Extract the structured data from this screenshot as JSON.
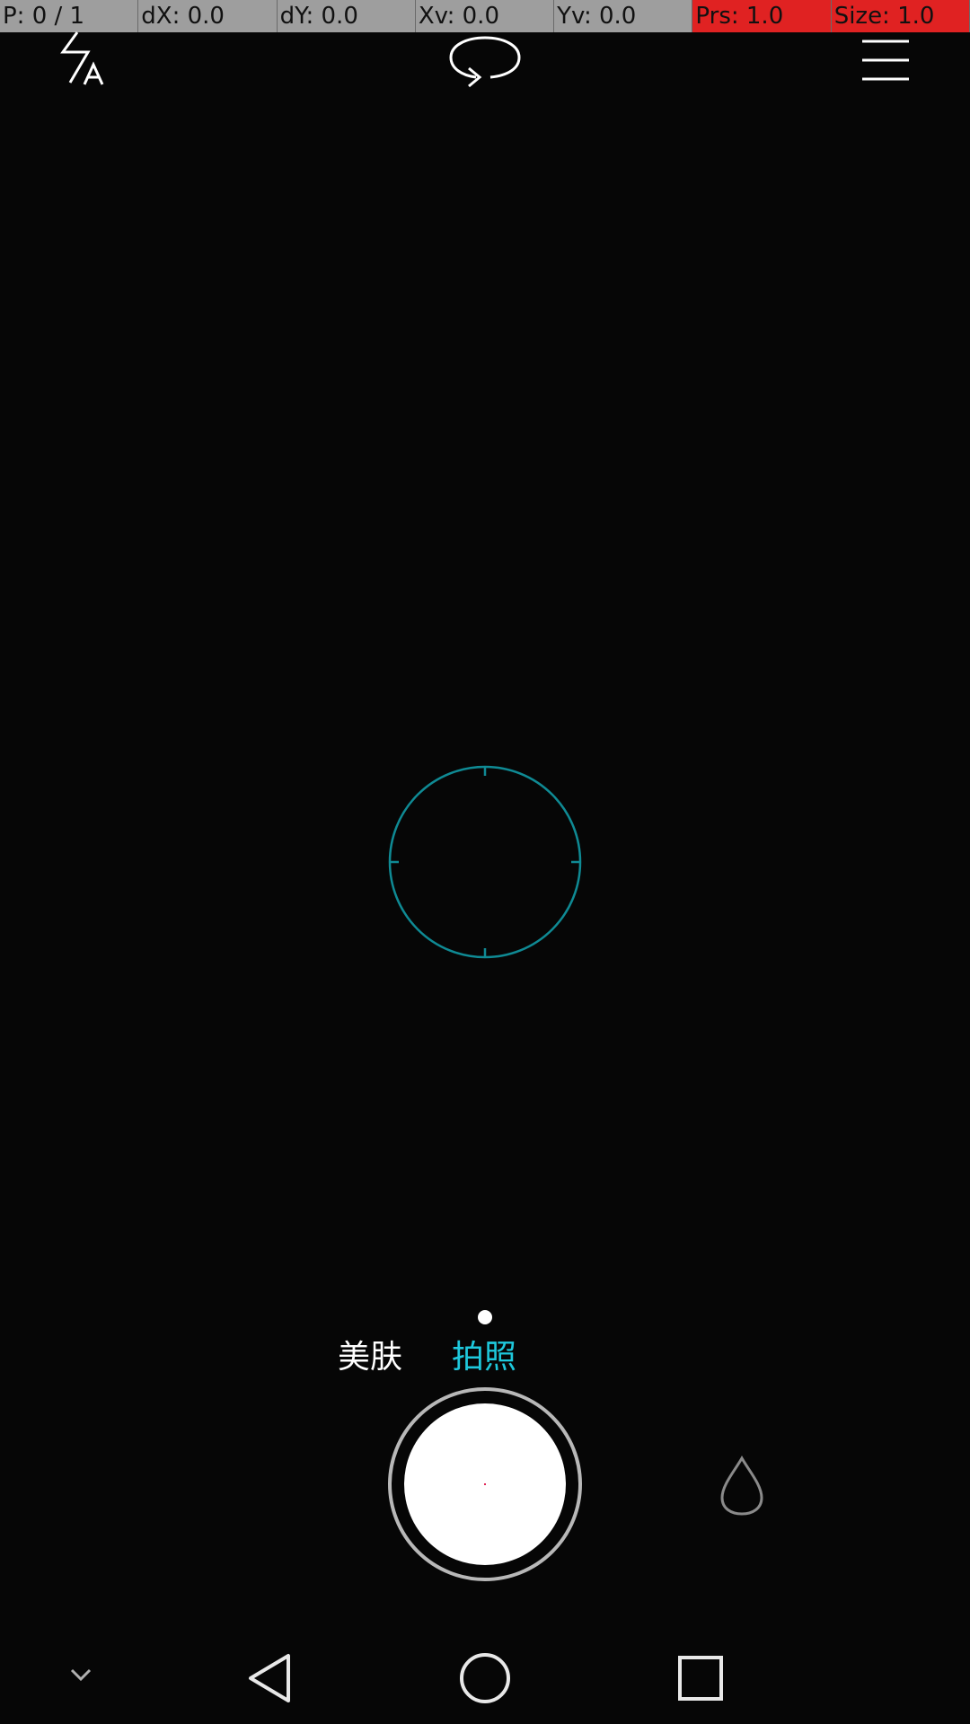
{
  "pointer_overlay": {
    "pointers": "P: 0 / 1",
    "dx": "dX: 0.0",
    "dy": "dY: 0.0",
    "xv": "Xv: 0.0",
    "yv": "Yv: 0.0",
    "pressure": "Prs: 1.0",
    "size": "Size: 1.0"
  },
  "toolbar": {
    "flash_icon": "flash-auto-icon",
    "switch_icon": "switch-camera-icon",
    "menu_icon": "menu-icon"
  },
  "modes": {
    "items": [
      "美肤",
      "拍照"
    ],
    "selected": "拍照"
  },
  "controls": {
    "shutter_icon": "shutter-button",
    "filter_icon": "water-drop-icon"
  },
  "navigation": {
    "hide_icon": "chevron-down-icon",
    "back_icon": "triangle-back-icon",
    "home_icon": "circle-home-icon",
    "recent_icon": "square-recents-icon"
  },
  "colors": {
    "accent": "#1ec8dc",
    "focus_ring": "#0f8a94",
    "overlay_gray": "#9e9e9e",
    "overlay_red": "#e02222",
    "background": "#060606"
  }
}
